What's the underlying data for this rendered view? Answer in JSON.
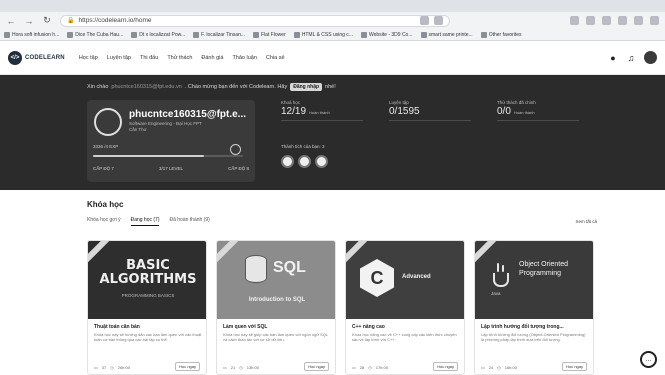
{
  "browser": {
    "url": "https://codelearn.io/home",
    "bookmarks": [
      "Hora soft infusion h...",
      "Dice The Cuba Hau...",
      "Dt x localizzat Pow...",
      "F.  localizar Tinsan...",
      "Flat Flower",
      "HTML & CSS using c...",
      "Website - 3D9 Co...",
      "smart same printe...",
      "Other favorites"
    ]
  },
  "site": {
    "logo_text": "CODELEARN",
    "nav": [
      "Học tập",
      "Luyện tập",
      "Thi đấu",
      "Thử thách",
      "Đánh giá",
      "Thảo luận",
      "Chia sẻ"
    ]
  },
  "hero": {
    "welcome_prefix": "Xin chào",
    "email": "phucntce160315@fpt.edu.vn",
    "welcome_suffix": ". Chào mừng bạn đến với Codelearn. Hãy",
    "download_label": "Đăng nhập",
    "welcome_end": "nhé!",
    "profile": {
      "name": "phucntce160315@fpt.e...",
      "school": "Software Engineering - Đại Học FPT Cần Thơ",
      "exp": "3336 /4 EXP",
      "exp_progress": 0.74,
      "level_left": "CẤP ĐỘ 7",
      "level_mid": "3/17 LEVEL",
      "level_right": "CẤP ĐỘ 8"
    },
    "stats": [
      {
        "label": "Khoá học",
        "value": "12/19",
        "sub": "Hoàn thành"
      },
      {
        "label": "Luyện tập",
        "value": "0/1595",
        "sub": ""
      },
      {
        "label": "Thử thách đã chinh",
        "value": "0/0",
        "sub": "Hoàn thành"
      }
    ],
    "badges_label": "Thành tích của bạn: 3"
  },
  "courses": {
    "title": "Khóa học",
    "tabs": [
      "Khóa học gợi ý",
      "Đang học (7)",
      "Đã hoàn thành (9)"
    ],
    "active_tab": 1,
    "see_all": "Xem tất cả",
    "items": [
      {
        "title": "Thuật toán căn bản",
        "desc": "Khóa học này sẽ hướng dẫn các bạn làm quen với các thuật toán cơ bản thông qua các bài tập cụ thể.",
        "thumb_title": "BASIC ALGORITHMS",
        "thumb_sub": "PROGRAMMING BASICS",
        "lessons": "37",
        "time": "26h:00",
        "btn": "Học ngay"
      },
      {
        "title": "Làm quen với SQL",
        "desc": "Khóa học này sẽ giúp các bạn làm quen với ngôn ngữ SQL và cách thao tác với cơ sở dữ liệu.",
        "thumb_title": "SQL",
        "thumb_sub": "Introduction to SQL",
        "lessons": "21",
        "time": "13h:00",
        "btn": "Học ngay"
      },
      {
        "title": "C++ nâng cao",
        "desc": "Khóa học nâng cao về C++ cung cấp các kiến thức chuyên sâu về lập trình với C++.",
        "thumb_title": "Advanced",
        "thumb_sub": "C",
        "lessons": "28",
        "time": "17h:00",
        "btn": "Học ngay"
      },
      {
        "title": "Lập trình hướng đối tượng trong...",
        "desc": "Lập trình hướng đối tượng (Object-Oriented Programming) là phương pháp lập trình dựa trên đối tượng.",
        "thumb_title": "Object Oriented Programming",
        "thumb_sub": "Java",
        "lessons": "24",
        "time": "16h:00",
        "btn": "Học ngay"
      }
    ]
  }
}
